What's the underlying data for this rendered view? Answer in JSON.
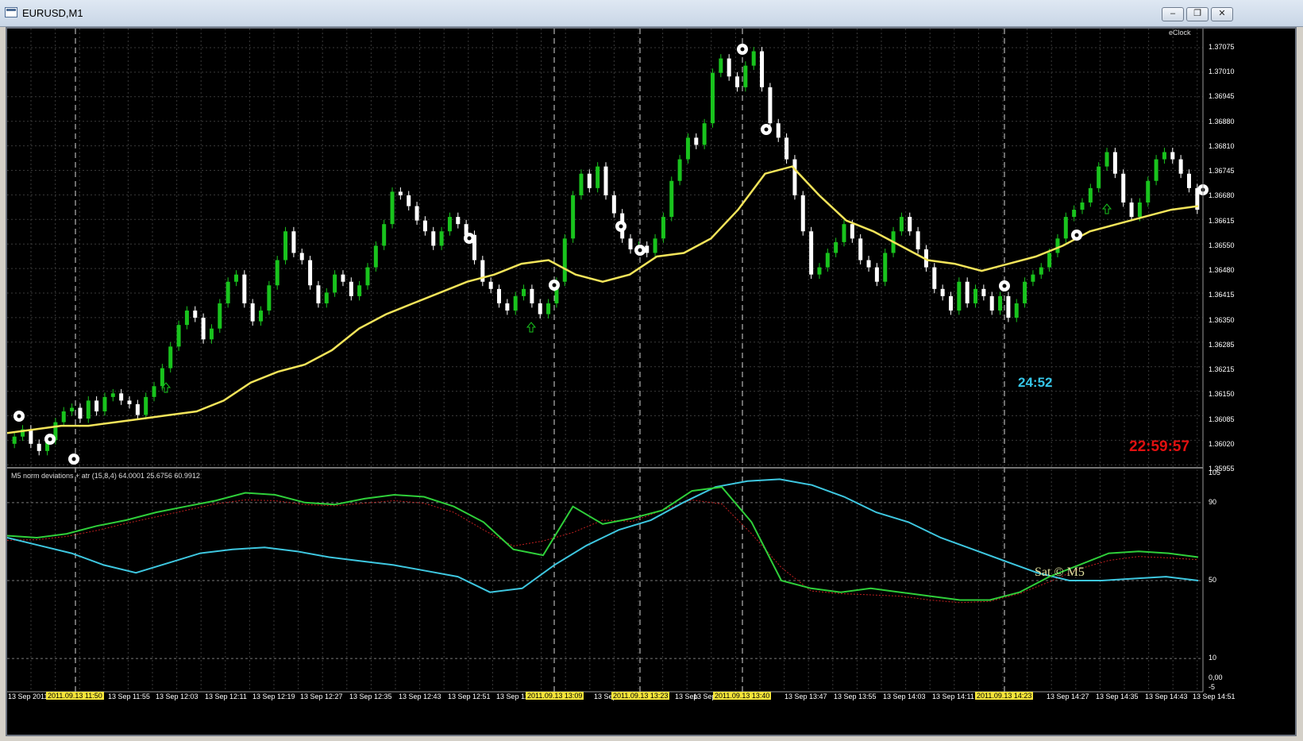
{
  "window": {
    "title": "EURUSD,M1",
    "minimize_icon": "minimize-icon",
    "restore_icon": "restore-icon",
    "close_icon": "close-icon"
  },
  "chart": {
    "eclock_label": "eClock",
    "countdown_a": "24:52",
    "countdown_b": "22:59:57",
    "indicator_title": "M5   norm deviations + atr  (15,8,4) 64.0001  25.6756  60.9912",
    "sat_label": "Sat © M5",
    "colors": {
      "bull_candle": "#19c31d",
      "bear_candle": "#ffffff",
      "ma_line": "#f3e45a",
      "ind_green": "#2fcf3a",
      "ind_cyan": "#3ec7e0",
      "ind_red_dotted": "#c02020",
      "grid": "#3a3a3a",
      "date_highlight": "#f5e53a"
    }
  },
  "chart_data": {
    "type": "candlestick",
    "symbol": "EURUSD",
    "timeframe": "M1",
    "price_axis_labels": [
      "1.37075",
      "1.37010",
      "1.36945",
      "1.36880",
      "1.36810",
      "1.36745",
      "1.36680",
      "1.36615",
      "1.36550",
      "1.36480",
      "1.36415",
      "1.36350",
      "1.36285",
      "1.36215",
      "1.36150",
      "1.36085",
      "1.36020",
      "1.35955"
    ],
    "price_range": [
      1.3595,
      1.3711
    ],
    "close": [
      1.3603,
      1.3605,
      1.3601,
      1.3599,
      1.3602,
      1.3607,
      1.361,
      1.3611,
      1.3608,
      1.3613,
      1.361,
      1.3614,
      1.3615,
      1.3613,
      1.3612,
      1.3609,
      1.3614,
      1.3617,
      1.3622,
      1.3628,
      1.3634,
      1.3638,
      1.3636,
      1.363,
      1.3633,
      1.364,
      1.3646,
      1.3648,
      1.364,
      1.3635,
      1.3638,
      1.3645,
      1.3652,
      1.366,
      1.3654,
      1.3652,
      1.3645,
      1.364,
      1.3643,
      1.3648,
      1.3646,
      1.3642,
      1.3645,
      1.365,
      1.3656,
      1.3662,
      1.3671,
      1.367,
      1.3667,
      1.3663,
      1.366,
      1.3656,
      1.366,
      1.3664,
      1.3662,
      1.3659,
      1.3652,
      1.3646,
      1.3644,
      1.364,
      1.3638,
      1.3642,
      1.3644,
      1.364,
      1.3637,
      1.364,
      1.3646,
      1.3658,
      1.367,
      1.3676,
      1.3672,
      1.3678,
      1.367,
      1.3665,
      1.3658,
      1.3655,
      1.3656,
      1.3654,
      1.3658,
      1.3664,
      1.3674,
      1.368,
      1.3686,
      1.3684,
      1.369,
      1.3704,
      1.3708,
      1.3703,
      1.37,
      1.3706,
      1.371,
      1.37,
      1.369,
      1.3686,
      1.368,
      1.367,
      1.366,
      1.3648,
      1.365,
      1.3654,
      1.3657,
      1.3662,
      1.3658,
      1.3652,
      1.365,
      1.3646,
      1.3654,
      1.366,
      1.3664,
      1.366,
      1.3655,
      1.365,
      1.3644,
      1.3642,
      1.3638,
      1.3646,
      1.364,
      1.3644,
      1.3642,
      1.3638,
      1.3642,
      1.3636,
      1.364,
      1.3646,
      1.3648,
      1.365,
      1.3654,
      1.3658,
      1.3664,
      1.3666,
      1.3668,
      1.3672,
      1.3678,
      1.3682,
      1.3676,
      1.3668,
      1.3664,
      1.3668,
      1.3674,
      1.368,
      1.3682,
      1.368,
      1.3676,
      1.3672,
      1.3666
    ],
    "ma": [
      1.3604,
      1.3605,
      1.3606,
      1.3606,
      1.3607,
      1.3608,
      1.3609,
      1.361,
      1.3613,
      1.3618,
      1.3621,
      1.3623,
      1.3627,
      1.3633,
      1.3637,
      1.364,
      1.3643,
      1.3646,
      1.3648,
      1.3651,
      1.3652,
      1.3648,
      1.3646,
      1.3648,
      1.3653,
      1.3654,
      1.3658,
      1.3666,
      1.3676,
      1.3678,
      1.367,
      1.3663,
      1.366,
      1.3656,
      1.3652,
      1.3651,
      1.3649,
      1.3651,
      1.3653,
      1.3656,
      1.366,
      1.3662,
      1.3664,
      1.3666,
      1.3667
    ],
    "indicator": {
      "scale_labels": [
        "105",
        "90",
        "50",
        "10",
        "0,00",
        "-5"
      ],
      "range": [
        -5,
        105
      ],
      "green": [
        73,
        72,
        74,
        78,
        81,
        85,
        88,
        91,
        95,
        94,
        90,
        89,
        92,
        94,
        93,
        88,
        80,
        66,
        63,
        88,
        79,
        82,
        86,
        96,
        98,
        80,
        50,
        46,
        44,
        46,
        44,
        42,
        40,
        40,
        44,
        52,
        58,
        64,
        65,
        64,
        62
      ],
      "cyan": [
        72,
        68,
        64,
        58,
        54,
        59,
        64,
        66,
        67,
        65,
        62,
        60,
        58,
        55,
        52,
        44,
        46,
        58,
        68,
        76,
        81,
        90,
        98,
        101,
        102,
        99,
        93,
        85,
        80,
        72,
        66,
        60,
        54,
        50,
        50,
        51,
        52,
        50
      ]
    },
    "time_axis_labels": [
      "13 Sep 2011",
      "13 Sep 11:55",
      "13 Sep 12:03",
      "13 Sep 12:11",
      "13 Sep 12:19",
      "13 Sep 12:27",
      "13 Sep 12:35",
      "13 Sep 12:43",
      "13 Sep 12:51",
      "13 Sep 12",
      "13 Sep",
      "13 Sep",
      "13 Sep",
      "9",
      "13 Sep 13:47",
      "13 Sep 13:55",
      "13 Sep 14:03",
      "13 Sep 14:11",
      "13 Sep 14:27",
      "13 Sep 14:35",
      "13 Sep 14:43",
      "13 Sep 14:51"
    ],
    "highlighted_dates": [
      "2011.09.13 11:50",
      "2011.09.13 13:09",
      "2011.09.13 13:23",
      "2011.09.13 13:40",
      "2011.09.13 14:23"
    ]
  }
}
